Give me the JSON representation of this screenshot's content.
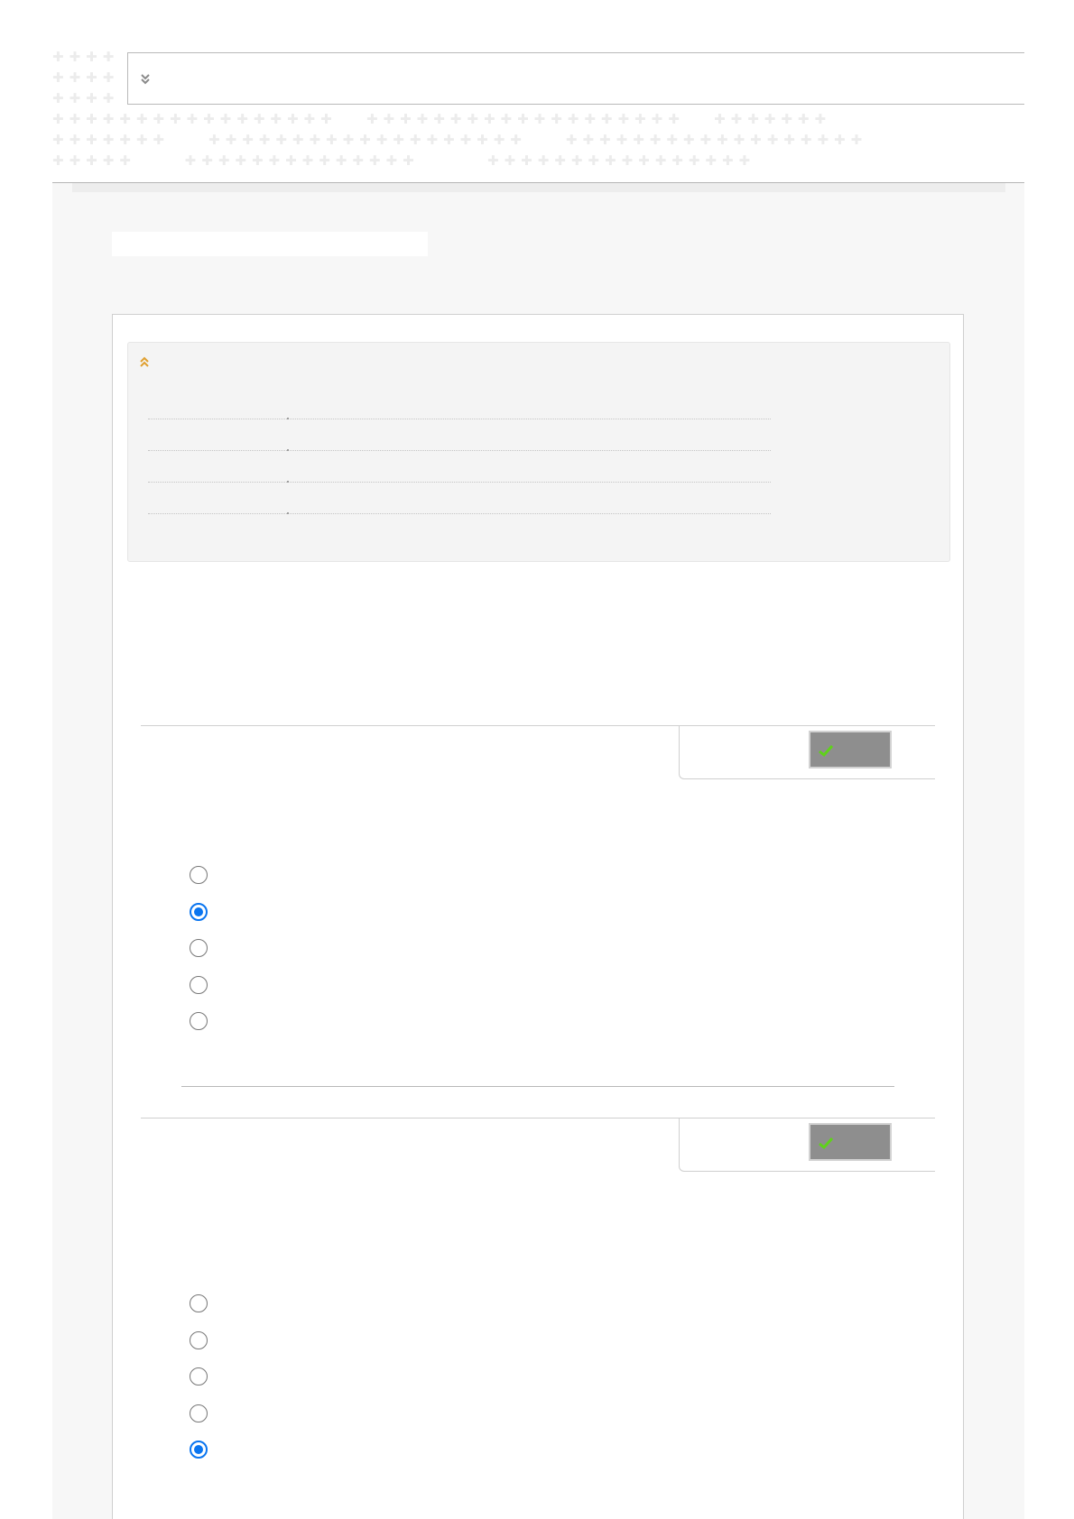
{
  "header": {
    "title": "",
    "expand_icon": "double-chevron-down-icon"
  },
  "page_title": "",
  "info_box": {
    "collapse_icon": "double-chevron-up-icon",
    "collapse_icon_color": "#e0a030",
    "rows": [
      {
        "label": "",
        "value": ""
      },
      {
        "label": "",
        "value": ""
      },
      {
        "label": "",
        "value": ""
      },
      {
        "label": "",
        "value": ""
      }
    ]
  },
  "questions": [
    {
      "text": "",
      "check_button": {
        "label": "",
        "icon": "green-check-icon"
      },
      "options": [
        {
          "label": "",
          "selected": false
        },
        {
          "label": "",
          "selected": true
        },
        {
          "label": "",
          "selected": false
        },
        {
          "label": "",
          "selected": false
        },
        {
          "label": "",
          "selected": false
        }
      ]
    },
    {
      "text": "",
      "check_button": {
        "label": "",
        "icon": "green-check-icon"
      },
      "options": [
        {
          "label": "",
          "selected": false
        },
        {
          "label": "",
          "selected": false
        },
        {
          "label": "",
          "selected": false
        },
        {
          "label": "",
          "selected": false
        },
        {
          "label": "",
          "selected": true
        }
      ]
    }
  ],
  "colors": {
    "accent": "#0a75f0",
    "check_green": "#5fd21a",
    "button_gray": "#8e8e8e",
    "background": "#f7f7f7"
  }
}
